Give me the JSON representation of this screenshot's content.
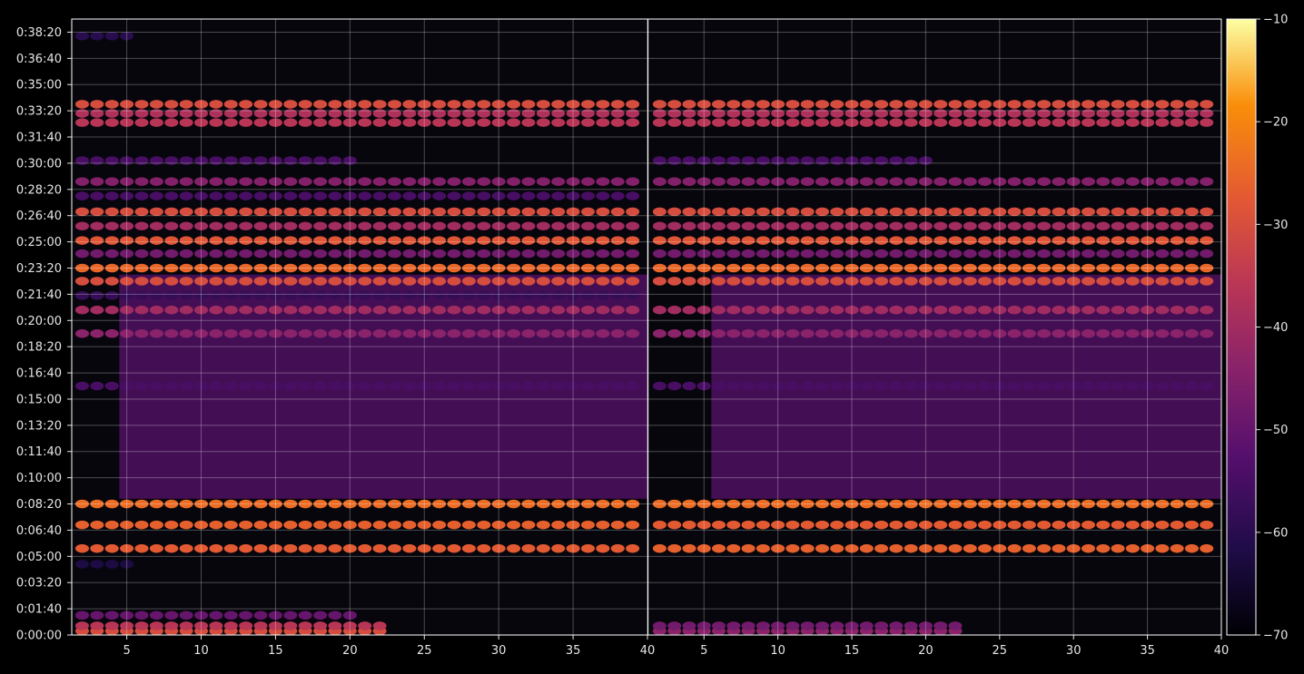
{
  "chart_data": {
    "type": "heatmap",
    "title": "",
    "xlabel": "",
    "ylabel": "",
    "background": "#000000",
    "grid": true,
    "colormap": "inferno",
    "colorbar": {
      "min": -70,
      "max": -10,
      "ticks": [
        -70,
        -60,
        -50,
        -40,
        -30,
        -20,
        -10
      ],
      "tick_labels": [
        "−70",
        "−60",
        "−50",
        "−40",
        "−30",
        "−20",
        "−10"
      ]
    },
    "y_axis": {
      "min_seconds": 0,
      "max_seconds": 2350,
      "ticks_seconds": [
        0,
        100,
        200,
        300,
        400,
        500,
        600,
        700,
        800,
        900,
        1000,
        1100,
        1200,
        1300,
        1400,
        1500,
        1600,
        1700,
        1800,
        1900,
        2000,
        2100,
        2200,
        2300
      ],
      "tick_labels": [
        "0:00:00",
        "0:01:40",
        "0:03:20",
        "0:05:00",
        "0:06:40",
        "0:08:20",
        "0:10:00",
        "0:11:40",
        "0:13:20",
        "0:15:00",
        "0:16:40",
        "0:18:20",
        "0:20:00",
        "0:21:40",
        "0:23:20",
        "0:25:00",
        "0:26:40",
        "0:28:20",
        "0:30:00",
        "0:31:40",
        "0:33:20",
        "0:35:00",
        "0:36:40",
        "0:38:20"
      ]
    },
    "panels": [
      {
        "x_range": [
          1.3,
          40
        ],
        "x_ticks": [
          5,
          10,
          15,
          20,
          25,
          30,
          35,
          40
        ],
        "x_tick_labels": [
          "5",
          "10",
          "15",
          "20",
          "25",
          "30",
          "35",
          "40"
        ],
        "bands": [
          {
            "t": 15,
            "v": -30,
            "x": [
              1,
              22
            ]
          },
          {
            "t": 35,
            "v": -36,
            "x": [
              1,
              22
            ]
          },
          {
            "t": 75,
            "v": -50,
            "x": [
              1,
              20
            ]
          },
          {
            "t": 270,
            "v": -62,
            "x": [
              1,
              5
            ]
          },
          {
            "t": 330,
            "v": -27,
            "x": [
              1,
              40
            ]
          },
          {
            "t": 420,
            "v": -26,
            "x": [
              1,
              40
            ]
          },
          {
            "t": 500,
            "v": -24,
            "x": [
              1,
              40
            ]
          },
          {
            "t": 950,
            "v": -55,
            "x": [
              1,
              40
            ]
          },
          {
            "t": 1150,
            "v": -44,
            "x": [
              1,
              40
            ]
          },
          {
            "t": 1240,
            "v": -40,
            "x": [
              1,
              40
            ]
          },
          {
            "t": 1295,
            "v": -58,
            "x": [
              1,
              40
            ]
          },
          {
            "t": 1350,
            "v": -30,
            "x": [
              1,
              40
            ]
          },
          {
            "t": 1400,
            "v": -25,
            "x": [
              1,
              40
            ]
          },
          {
            "t": 1455,
            "v": -48,
            "x": [
              1,
              40
            ]
          },
          {
            "t": 1505,
            "v": -28,
            "x": [
              1,
              40
            ]
          },
          {
            "t": 1560,
            "v": -40,
            "x": [
              1,
              40
            ]
          },
          {
            "t": 1615,
            "v": -30,
            "x": [
              1,
              40
            ]
          },
          {
            "t": 1675,
            "v": -55,
            "x": [
              1,
              40
            ]
          },
          {
            "t": 1730,
            "v": -45,
            "x": [
              1,
              40
            ]
          },
          {
            "t": 1810,
            "v": -55,
            "x": [
              1,
              20
            ]
          },
          {
            "t": 1955,
            "v": -36,
            "x": [
              1,
              40
            ]
          },
          {
            "t": 1990,
            "v": -38,
            "x": [
              1,
              40
            ]
          },
          {
            "t": 2025,
            "v": -30,
            "x": [
              1,
              40
            ]
          },
          {
            "t": 2285,
            "v": -60,
            "x": [
              1,
              5
            ]
          }
        ],
        "fill": {
          "t": [
            520,
            1375
          ],
          "x": [
            4.5,
            40
          ],
          "v": -52
        }
      },
      {
        "x_range": [
          1.3,
          40
        ],
        "x_ticks": [
          5,
          10,
          15,
          20,
          25,
          30,
          35,
          40
        ],
        "x_tick_labels": [
          "5",
          "10",
          "15",
          "20",
          "25",
          "30",
          "35",
          "40"
        ],
        "bands": [
          {
            "t": 15,
            "v": -44,
            "x": [
              1,
              22
            ]
          },
          {
            "t": 35,
            "v": -48,
            "x": [
              1,
              22
            ]
          },
          {
            "t": 330,
            "v": -26,
            "x": [
              1,
              40
            ]
          },
          {
            "t": 420,
            "v": -27,
            "x": [
              1,
              40
            ]
          },
          {
            "t": 500,
            "v": -24,
            "x": [
              1,
              40
            ]
          },
          {
            "t": 950,
            "v": -55,
            "x": [
              1,
              40
            ]
          },
          {
            "t": 1150,
            "v": -44,
            "x": [
              1,
              40
            ]
          },
          {
            "t": 1240,
            "v": -40,
            "x": [
              1,
              40
            ]
          },
          {
            "t": 1350,
            "v": -30,
            "x": [
              1,
              40
            ]
          },
          {
            "t": 1400,
            "v": -25,
            "x": [
              1,
              40
            ]
          },
          {
            "t": 1455,
            "v": -48,
            "x": [
              1,
              40
            ]
          },
          {
            "t": 1505,
            "v": -28,
            "x": [
              1,
              40
            ]
          },
          {
            "t": 1560,
            "v": -40,
            "x": [
              1,
              40
            ]
          },
          {
            "t": 1615,
            "v": -30,
            "x": [
              1,
              40
            ]
          },
          {
            "t": 1730,
            "v": -45,
            "x": [
              1,
              40
            ]
          },
          {
            "t": 1810,
            "v": -55,
            "x": [
              1,
              20
            ]
          },
          {
            "t": 1955,
            "v": -36,
            "x": [
              1,
              40
            ]
          },
          {
            "t": 1990,
            "v": -38,
            "x": [
              1,
              40
            ]
          },
          {
            "t": 2025,
            "v": -30,
            "x": [
              1,
              40
            ]
          }
        ],
        "fill": {
          "t": [
            520,
            1375
          ],
          "x": [
            5.5,
            40
          ],
          "v": -52
        }
      }
    ]
  }
}
